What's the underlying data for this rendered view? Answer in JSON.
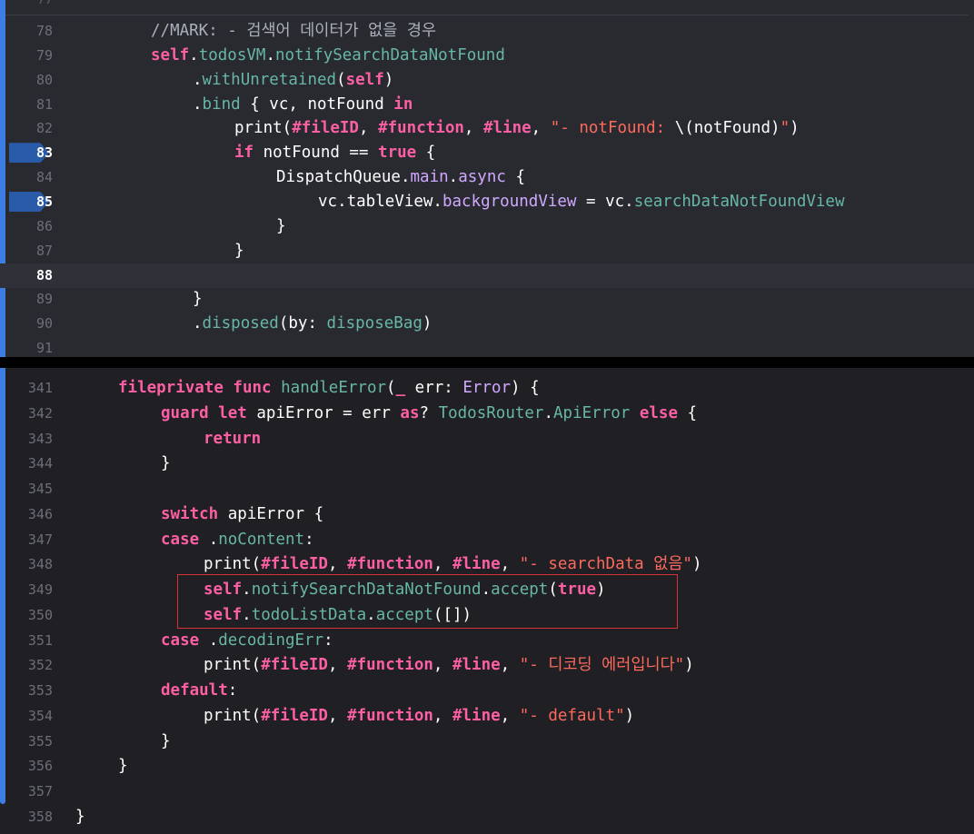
{
  "pane1": {
    "top_partial_line_number": "77",
    "lines": [
      {
        "n": "78",
        "tokens": [
          [
            "cm",
            "//MARK: - 검색어 데이터가 없을 경우"
          ]
        ]
      },
      {
        "n": "79",
        "tokens": [
          [
            "kw",
            "self"
          ],
          [
            "pl",
            "."
          ],
          [
            "fn",
            "todosVM"
          ],
          [
            "pl",
            "."
          ],
          [
            "fn",
            "notifySearchDataNotFound"
          ]
        ]
      },
      {
        "n": "80",
        "tokens": [
          [
            "pl",
            "."
          ],
          [
            "fn",
            "withUnretained"
          ],
          [
            "pl",
            "("
          ],
          [
            "kw",
            "self"
          ],
          [
            "pl",
            ")"
          ]
        ]
      },
      {
        "n": "81",
        "tokens": [
          [
            "pl",
            "."
          ],
          [
            "fn",
            "bind"
          ],
          [
            "pl",
            " { vc, notFound "
          ],
          [
            "kw",
            "in"
          ]
        ]
      },
      {
        "n": "82",
        "tokens": [
          [
            "pl",
            "print("
          ],
          [
            "kw",
            "#fileID"
          ],
          [
            "pl",
            ", "
          ],
          [
            "kw",
            "#function"
          ],
          [
            "pl",
            ", "
          ],
          [
            "kw",
            "#line"
          ],
          [
            "pl",
            ", "
          ],
          [
            "st",
            "\"- notFound: "
          ],
          [
            "pl",
            "\\(notFound)"
          ],
          [
            "st",
            "\""
          ],
          [
            "pl",
            ")"
          ]
        ]
      },
      {
        "n": "83",
        "tokens": [
          [
            "kw",
            "if"
          ],
          [
            "pl",
            " notFound == "
          ],
          [
            "kw",
            "true"
          ],
          [
            "pl",
            " {"
          ]
        ]
      },
      {
        "n": "84",
        "tokens": [
          [
            "pl",
            "DispatchQueue."
          ],
          [
            "ty",
            "main"
          ],
          [
            "pl",
            "."
          ],
          [
            "ty",
            "async"
          ],
          [
            "pl",
            " {"
          ]
        ]
      },
      {
        "n": "85",
        "tokens": [
          [
            "pl",
            "vc.tableView."
          ],
          [
            "ty",
            "backgroundView"
          ],
          [
            "pl",
            " = vc."
          ],
          [
            "fn",
            "searchDataNotFoundView"
          ]
        ]
      },
      {
        "n": "86",
        "tokens": [
          [
            "pl",
            "}"
          ]
        ]
      },
      {
        "n": "87",
        "tokens": [
          [
            "pl",
            "}"
          ]
        ]
      },
      {
        "n": "88",
        "tokens": []
      },
      {
        "n": "89",
        "tokens": [
          [
            "pl",
            "}"
          ]
        ]
      },
      {
        "n": "90",
        "tokens": [
          [
            "pl",
            "."
          ],
          [
            "fn",
            "disposed"
          ],
          [
            "pl",
            "(by: "
          ],
          [
            "fn",
            "disposeBag"
          ],
          [
            "pl",
            ")"
          ]
        ]
      },
      {
        "n": "91",
        "tokens": []
      }
    ]
  },
  "pane2": {
    "lines": [
      {
        "n": "341",
        "tokens": [
          [
            "kw",
            "fileprivate func"
          ],
          [
            "pl",
            " "
          ],
          [
            "fn",
            "handleError"
          ],
          [
            "pl",
            "("
          ],
          [
            "kw",
            "_"
          ],
          [
            "pl",
            " err: "
          ],
          [
            "ty",
            "Error"
          ],
          [
            "pl",
            ") {"
          ]
        ]
      },
      {
        "n": "342",
        "tokens": [
          [
            "kw",
            "guard let"
          ],
          [
            "pl",
            " apiError = err "
          ],
          [
            "kw",
            "as"
          ],
          [
            "pl",
            "? "
          ],
          [
            "fn",
            "TodosRouter"
          ],
          [
            "pl",
            "."
          ],
          [
            "fn",
            "ApiError"
          ],
          [
            "pl",
            " "
          ],
          [
            "kw",
            "else"
          ],
          [
            "pl",
            " {"
          ]
        ]
      },
      {
        "n": "343",
        "tokens": [
          [
            "kw",
            "return"
          ]
        ]
      },
      {
        "n": "344",
        "tokens": [
          [
            "pl",
            "}"
          ]
        ]
      },
      {
        "n": "345",
        "tokens": []
      },
      {
        "n": "346",
        "tokens": [
          [
            "kw",
            "switch"
          ],
          [
            "pl",
            " apiError {"
          ]
        ]
      },
      {
        "n": "347",
        "tokens": [
          [
            "kw",
            "case"
          ],
          [
            "pl",
            " ."
          ],
          [
            "fn",
            "noContent"
          ],
          [
            "pl",
            ":"
          ]
        ]
      },
      {
        "n": "348",
        "tokens": [
          [
            "pl",
            "print("
          ],
          [
            "kw",
            "#fileID"
          ],
          [
            "pl",
            ", "
          ],
          [
            "kw",
            "#function"
          ],
          [
            "pl",
            ", "
          ],
          [
            "kw",
            "#line"
          ],
          [
            "pl",
            ", "
          ],
          [
            "st",
            "\"- searchData 없음\""
          ],
          [
            "pl",
            ")"
          ]
        ]
      },
      {
        "n": "349",
        "tokens": [
          [
            "kw",
            "self"
          ],
          [
            "pl",
            "."
          ],
          [
            "fn",
            "notifySearchDataNotFound"
          ],
          [
            "pl",
            "."
          ],
          [
            "fn",
            "accept"
          ],
          [
            "pl",
            "("
          ],
          [
            "kw",
            "true"
          ],
          [
            "pl",
            ")"
          ]
        ]
      },
      {
        "n": "350",
        "tokens": [
          [
            "kw",
            "self"
          ],
          [
            "pl",
            "."
          ],
          [
            "fn",
            "todoListData"
          ],
          [
            "pl",
            "."
          ],
          [
            "fn",
            "accept"
          ],
          [
            "pl",
            "([])"
          ]
        ]
      },
      {
        "n": "351",
        "tokens": [
          [
            "kw",
            "case"
          ],
          [
            "pl",
            " ."
          ],
          [
            "fn",
            "decodingErr"
          ],
          [
            "pl",
            ":"
          ]
        ]
      },
      {
        "n": "352",
        "tokens": [
          [
            "pl",
            "print("
          ],
          [
            "kw",
            "#fileID"
          ],
          [
            "pl",
            ", "
          ],
          [
            "kw",
            "#function"
          ],
          [
            "pl",
            ", "
          ],
          [
            "kw",
            "#line"
          ],
          [
            "pl",
            ", "
          ],
          [
            "st",
            "\"- 디코딩 에러입니다\""
          ],
          [
            "pl",
            ")"
          ]
        ]
      },
      {
        "n": "353",
        "tokens": [
          [
            "kw",
            "default"
          ],
          [
            "pl",
            ":"
          ]
        ]
      },
      {
        "n": "354",
        "tokens": [
          [
            "pl",
            "print("
          ],
          [
            "kw",
            "#fileID"
          ],
          [
            "pl",
            ", "
          ],
          [
            "kw",
            "#function"
          ],
          [
            "pl",
            ", "
          ],
          [
            "kw",
            "#line"
          ],
          [
            "pl",
            ", "
          ],
          [
            "st",
            "\"- default\""
          ],
          [
            "pl",
            ")"
          ]
        ]
      },
      {
        "n": "355",
        "tokens": [
          [
            "pl",
            "}"
          ]
        ]
      },
      {
        "n": "356",
        "tokens": [
          [
            "pl",
            "}"
          ]
        ]
      },
      {
        "n": "357",
        "tokens": []
      },
      {
        "n": "358",
        "tokens": [
          [
            "pl",
            "}"
          ]
        ]
      }
    ]
  },
  "breakpoints": [
    "83",
    "85"
  ],
  "current_line": "88",
  "colors": {
    "keyword": "#fc5fa3",
    "comment": "#a9b0bc",
    "function": "#67b7a4",
    "type": "#d0a8ff",
    "string": "#fc6a5d",
    "highlight_box": "#d6323a",
    "change_bar": "#3d7ee5"
  }
}
